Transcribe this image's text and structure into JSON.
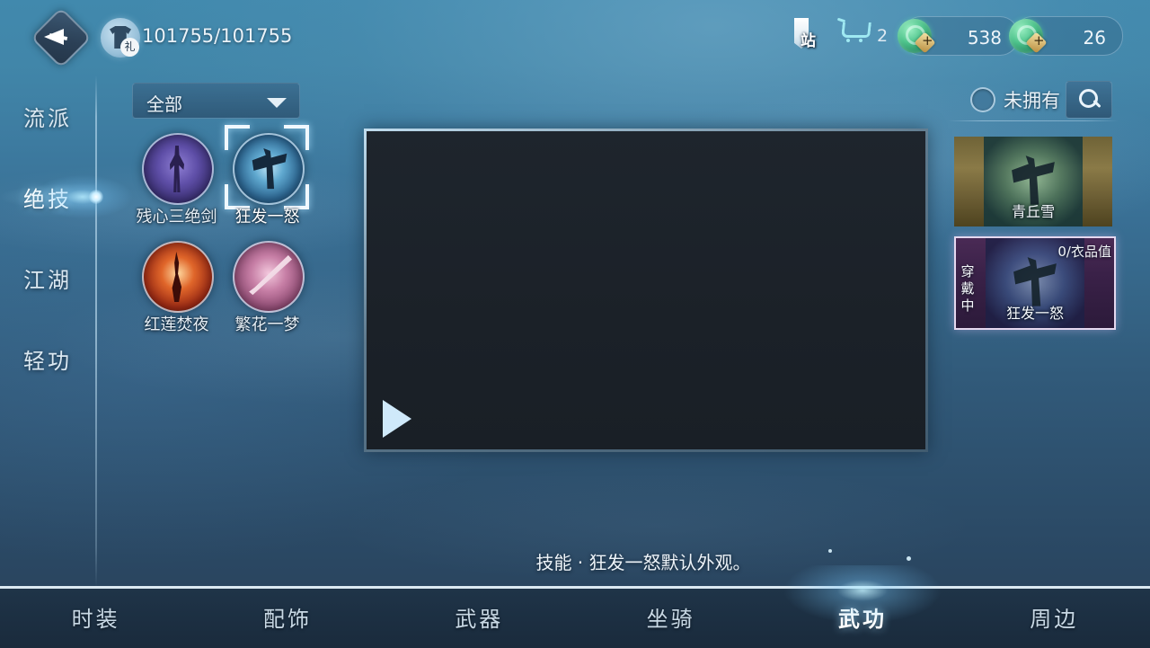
{
  "topbar": {
    "back_icon": "back-arrow-icon",
    "avatar_icon": "avatar-shirt-icon",
    "avatar_badge": "礼",
    "hp_value": "101755/101755",
    "shop_icon_label": "站",
    "cart_icon": "cart-icon",
    "cart_count": "2",
    "currencies": [
      {
        "icon": "jade-orb-icon",
        "value": "538"
      },
      {
        "icon": "jade-orb-icon",
        "value": "26"
      }
    ]
  },
  "sidebar": {
    "items": [
      {
        "label": "流派",
        "active": false
      },
      {
        "label": "绝技",
        "active": true
      },
      {
        "label": "江湖",
        "active": false
      },
      {
        "label": "轻功",
        "active": false
      }
    ]
  },
  "filter": {
    "selected": "全部",
    "caret_icon": "chevron-down-icon"
  },
  "skills": [
    {
      "name": "残心三绝剑",
      "selected": false
    },
    {
      "name": "狂发一怒",
      "selected": true
    },
    {
      "name": "红莲焚夜",
      "selected": false
    },
    {
      "name": "繁花一梦",
      "selected": false
    }
  ],
  "preview": {
    "play_icon": "play-icon",
    "caption": "技能 · 狂发一怒默认外观。"
  },
  "right_panel": {
    "owned_filter_label": "未拥有",
    "owned_radio_icon": "radio-unchecked-icon",
    "search_icon": "search-icon",
    "cards": [
      {
        "name": "青丘雪",
        "selected": false,
        "value": "",
        "badge": ""
      },
      {
        "name": "狂发一怒",
        "selected": true,
        "value": "0/衣品值",
        "badge": "穿戴中"
      }
    ]
  },
  "bottom_tabs": [
    {
      "label": "时装",
      "active": false
    },
    {
      "label": "配饰",
      "active": false
    },
    {
      "label": "武器",
      "active": false
    },
    {
      "label": "坐骑",
      "active": false
    },
    {
      "label": "武功",
      "active": true
    },
    {
      "label": "周边",
      "active": false
    }
  ],
  "colors": {
    "accent": "#bfe6f8",
    "bg_top": "#4189ad",
    "bg_bottom": "#273f58",
    "selected_card_border": "#e5d8ef"
  }
}
